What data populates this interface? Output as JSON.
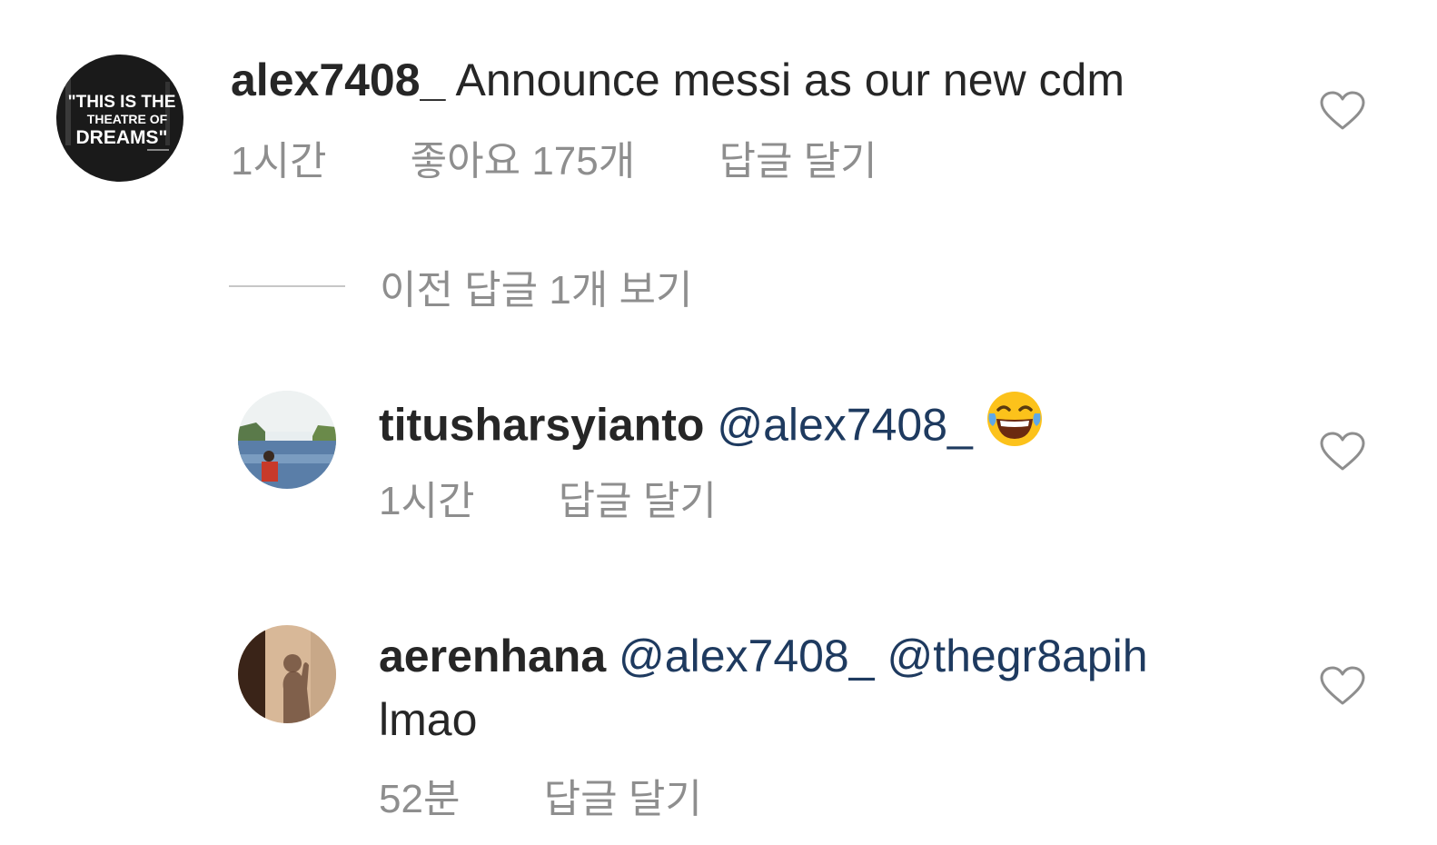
{
  "comments": [
    {
      "username": "alex7408_",
      "text": "Announce messi as our new cdm",
      "time": "1시간",
      "likes": "좋아요 175개",
      "reply": "답글 달기",
      "avatar_text": "\"THIS IS THE THEATRE OF DREAMS\""
    }
  ],
  "view_previous": "이전 답글 1개 보기",
  "replies": [
    {
      "username": "titusharsyianto",
      "mention": "@alex7408_",
      "emoji": "face-with-tears-of-joy",
      "time": "1시간",
      "reply": "답글 달기"
    },
    {
      "username": "aerenhana",
      "mention1": "@alex7408_",
      "mention2": "@thegr8apih",
      "text": "lmao",
      "time": "52분",
      "reply": "답글 달기"
    }
  ],
  "colors": {
    "text": "#262626",
    "meta": "#8e8e8e",
    "mention": "#1e3a5f"
  },
  "icons": [
    "heart-icon"
  ]
}
